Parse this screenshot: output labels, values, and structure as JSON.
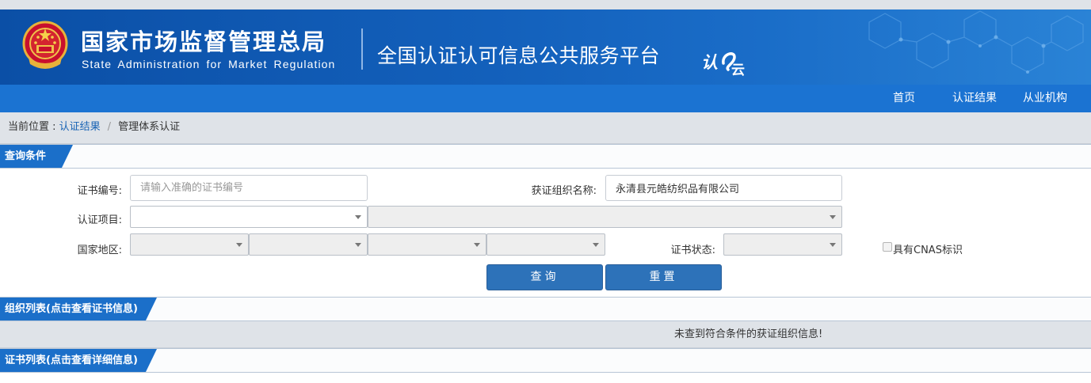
{
  "header": {
    "agency_name_cn": "国家市场监督管理总局",
    "agency_name_en": "State Administration  for  Market Regulation",
    "platform_name": "全国认证认可信息公共服务平台",
    "platform_logo_text": "认云",
    "emblem_icon": "national-emblem-icon"
  },
  "nav": {
    "items": [
      {
        "label": "首页"
      },
      {
        "label": "认证结果"
      },
      {
        "label": "从业机构"
      }
    ]
  },
  "breadcrumb": {
    "prefix": "当前位置 : ",
    "link": "认证结果",
    "separator": "/",
    "current": "管理体系认证"
  },
  "query": {
    "section_title": "查询条件",
    "cert_no_label": "证书编号:",
    "cert_no_placeholder": "请输入准确的证书编号",
    "cert_no_value": "",
    "org_name_label": "获证组织名称:",
    "org_name_value": "永清县元皓纺织品有限公司",
    "project_label": "认证项目:",
    "region_label": "国家地区:",
    "status_label": "证书状态:",
    "cnas_label": "具有CNAS标识",
    "search_button": "查询",
    "reset_button": "重置"
  },
  "org_list": {
    "section_title": "组织列表(点击查看证书信息)",
    "empty_message": "未查到符合条件的获证组织信息!"
  },
  "cert_list": {
    "section_title": "证书列表(点击查看详细信息)"
  },
  "colors": {
    "banner_blue": "#0b4fa6",
    "nav_blue": "#1b73d2",
    "tag_blue": "#1b6fc9",
    "button_blue": "#2d72b9",
    "link_blue": "#1a64b5"
  }
}
